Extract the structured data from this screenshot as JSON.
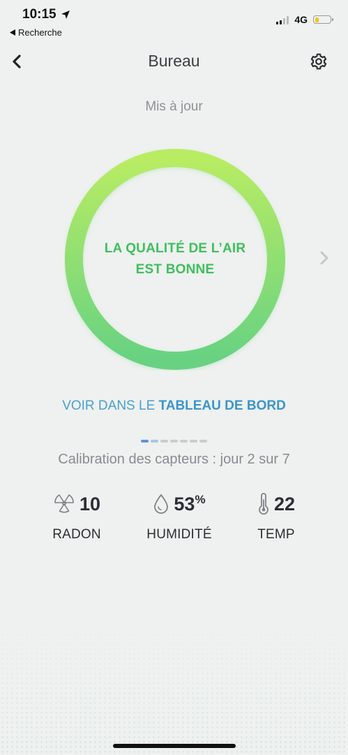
{
  "status_bar": {
    "time": "10:15",
    "back_app_label": "Recherche",
    "network": "4G",
    "battery_level": 0.25
  },
  "header": {
    "title": "Bureau"
  },
  "updated_text": "Mis à jour",
  "air_quality": {
    "line1": "LA QUALITÉ DE L’AIR",
    "line2": "EST BONNE",
    "ring_colors": [
      "#b9ec63",
      "#67d282"
    ]
  },
  "dashboard_link": {
    "prefix": "VOIR DANS LE ",
    "emphasis": "TABLEAU DE BORD"
  },
  "pager": {
    "count": 7,
    "active_index": 0
  },
  "calibration_text": "Calibration des capteurs : jour 2 sur 7",
  "metrics": {
    "radon": {
      "value": "10",
      "label": "RADON",
      "icon": "radon-icon"
    },
    "humidity": {
      "value": "53",
      "unit": "%",
      "label": "HUMIDITÉ",
      "icon": "droplet-icon"
    },
    "temp": {
      "value": "22",
      "label": "TEMP",
      "icon": "thermometer-icon"
    }
  },
  "colors": {
    "accent_green": "#3fbf5e",
    "link_blue": "#4a9fcf",
    "background": "#eef1ef"
  }
}
